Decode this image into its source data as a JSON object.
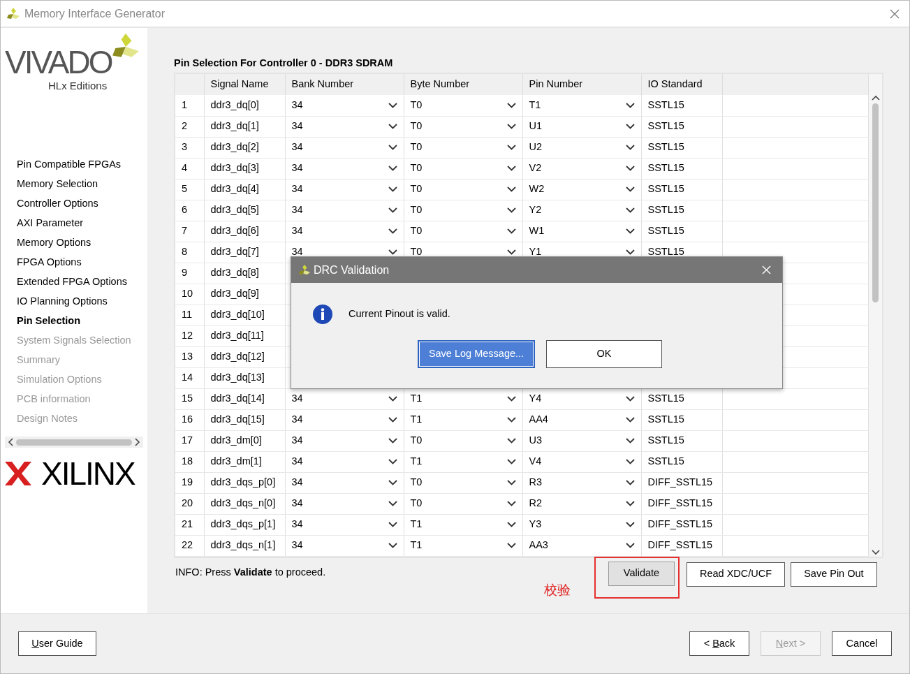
{
  "window": {
    "title": "Memory Interface Generator"
  },
  "sidebar": {
    "logo": {
      "name": "VIVADO",
      "subtitle": "HLx Editions"
    },
    "items": [
      {
        "label": "Pin Compatible FPGAs",
        "selected": false,
        "disabled": false
      },
      {
        "label": "Memory Selection",
        "selected": false,
        "disabled": false
      },
      {
        "label": "Controller Options",
        "selected": false,
        "disabled": false
      },
      {
        "label": "AXI Parameter",
        "selected": false,
        "disabled": false
      },
      {
        "label": "Memory Options",
        "selected": false,
        "disabled": false
      },
      {
        "label": "FPGA Options",
        "selected": false,
        "disabled": false
      },
      {
        "label": "Extended FPGA Options",
        "selected": false,
        "disabled": false
      },
      {
        "label": "IO Planning Options",
        "selected": false,
        "disabled": false
      },
      {
        "label": "Pin Selection",
        "selected": true,
        "disabled": false
      },
      {
        "label": "System Signals Selection",
        "selected": false,
        "disabled": true
      },
      {
        "label": "Summary",
        "selected": false,
        "disabled": true
      },
      {
        "label": "Simulation Options",
        "selected": false,
        "disabled": true
      },
      {
        "label": "PCB information",
        "selected": false,
        "disabled": true
      },
      {
        "label": "Design Notes",
        "selected": false,
        "disabled": true
      }
    ],
    "footer_logo": "XILINX"
  },
  "heading": "Pin Selection For Controller 0 - DDR3 SDRAM",
  "table": {
    "columns": [
      "Signal Name",
      "Bank Number",
      "Byte Number",
      "Pin Number",
      "IO Standard"
    ],
    "rows": [
      {
        "num": "1",
        "signal": "ddr3_dq[0]",
        "bank": "34",
        "byte": "T0",
        "pin": "T1",
        "io": "SSTL15"
      },
      {
        "num": "2",
        "signal": "ddr3_dq[1]",
        "bank": "34",
        "byte": "T0",
        "pin": "U1",
        "io": "SSTL15"
      },
      {
        "num": "3",
        "signal": "ddr3_dq[2]",
        "bank": "34",
        "byte": "T0",
        "pin": "U2",
        "io": "SSTL15"
      },
      {
        "num": "4",
        "signal": "ddr3_dq[3]",
        "bank": "34",
        "byte": "T0",
        "pin": "V2",
        "io": "SSTL15"
      },
      {
        "num": "5",
        "signal": "ddr3_dq[4]",
        "bank": "34",
        "byte": "T0",
        "pin": "W2",
        "io": "SSTL15"
      },
      {
        "num": "6",
        "signal": "ddr3_dq[5]",
        "bank": "34",
        "byte": "T0",
        "pin": "Y2",
        "io": "SSTL15"
      },
      {
        "num": "7",
        "signal": "ddr3_dq[6]",
        "bank": "34",
        "byte": "T0",
        "pin": "W1",
        "io": "SSTL15"
      },
      {
        "num": "8",
        "signal": "ddr3_dq[7]",
        "bank": "34",
        "byte": "T0",
        "pin": "Y1",
        "io": "SSTL15"
      },
      {
        "num": "9",
        "signal": "ddr3_dq[8]"
      },
      {
        "num": "10",
        "signal": "ddr3_dq[9]"
      },
      {
        "num": "11",
        "signal": "ddr3_dq[10]"
      },
      {
        "num": "12",
        "signal": "ddr3_dq[11]"
      },
      {
        "num": "13",
        "signal": "ddr3_dq[12]"
      },
      {
        "num": "14",
        "signal": "ddr3_dq[13]"
      },
      {
        "num": "15",
        "signal": "ddr3_dq[14]",
        "bank": "34",
        "byte": "T1",
        "pin": "Y4",
        "io": "SSTL15"
      },
      {
        "num": "16",
        "signal": "ddr3_dq[15]",
        "bank": "34",
        "byte": "T1",
        "pin": "AA4",
        "io": "SSTL15"
      },
      {
        "num": "17",
        "signal": "ddr3_dm[0]",
        "bank": "34",
        "byte": "T0",
        "pin": "U3",
        "io": "SSTL15"
      },
      {
        "num": "18",
        "signal": "ddr3_dm[1]",
        "bank": "34",
        "byte": "T1",
        "pin": "V4",
        "io": "SSTL15"
      },
      {
        "num": "19",
        "signal": "ddr3_dqs_p[0]",
        "bank": "34",
        "byte": "T0",
        "pin": "R3",
        "io": "DIFF_SSTL15"
      },
      {
        "num": "20",
        "signal": "ddr3_dqs_n[0]",
        "bank": "34",
        "byte": "T0",
        "pin": "R2",
        "io": "DIFF_SSTL15"
      },
      {
        "num": "21",
        "signal": "ddr3_dqs_p[1]",
        "bank": "34",
        "byte": "T1",
        "pin": "Y3",
        "io": "DIFF_SSTL15"
      },
      {
        "num": "22",
        "signal": "ddr3_dqs_n[1]",
        "bank": "34",
        "byte": "T1",
        "pin": "AA3",
        "io": "DIFF_SSTL15"
      }
    ]
  },
  "info": "INFO: Press **Validate** to proceed.",
  "annotation": "校验",
  "actions": [
    {
      "label": "Validate",
      "highlighted": true
    },
    {
      "label": "Read XDC/UCF",
      "highlighted": false
    },
    {
      "label": "Save Pin Out",
      "highlighted": false
    }
  ],
  "footer": {
    "left": [
      {
        "mnemonic": "U",
        "label_after": "ser Guide",
        "disabled": false
      }
    ],
    "right": [
      {
        "label_before": "< ",
        "mnemonic": "B",
        "label_after": "ack",
        "disabled": false
      },
      {
        "mnemonic": "N",
        "label_after": "ext >",
        "disabled": true
      },
      {
        "label_after": "Cancel",
        "disabled": false
      }
    ]
  },
  "dialog": {
    "title": "DRC Validation",
    "message": "Current Pinout is valid.",
    "buttons": [
      {
        "label": "Save Log Message...",
        "default": true
      },
      {
        "label": "OK",
        "default": false
      }
    ]
  }
}
